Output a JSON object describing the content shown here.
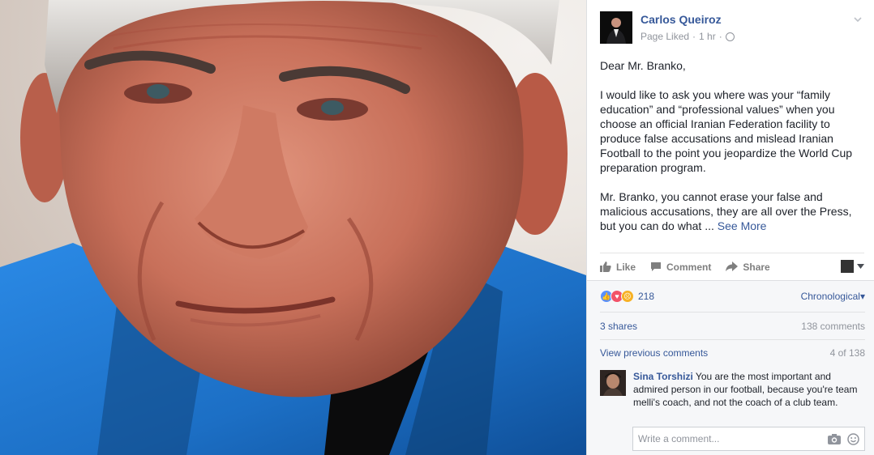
{
  "photo": {
    "subject": "portrait"
  },
  "post": {
    "author": "Carlos Queiroz",
    "meta_status": "Page Liked",
    "meta_sep": "·",
    "meta_time": "1 hr",
    "paragraphs": [
      "Dear Mr. Branko,",
      "I would like to ask you where was your “family education” and “professional values” when you choose an official Iranian Federation facility to produce false accusations and mislead Iranian Football to the point you jeopardize the World Cup preparation program.",
      "Mr. Branko, you cannot erase your false and malicious accusations, they are all over the Press, but you can do what ..."
    ],
    "see_more": "See More"
  },
  "actions": {
    "like": "Like",
    "comment": "Comment",
    "share": "Share"
  },
  "reactions": {
    "count": "218",
    "sort_label": "Chronological"
  },
  "stats": {
    "shares": "3 shares",
    "comments": "138 comments"
  },
  "comments_nav": {
    "view_previous": "View previous comments",
    "pager": "4 of 138"
  },
  "comment": {
    "author": "Sina Torshizi",
    "text": "You are the most important and admired person in our football, because you're team melli's coach, and not the coach of a club team."
  },
  "composer": {
    "placeholder": "Write a comment..."
  },
  "colors": {
    "link": "#365899",
    "jacket": "#1e78d2",
    "muted": "#90949c"
  },
  "icons": [
    "globe-icon",
    "chevron-down-icon",
    "like-icon",
    "comment-icon",
    "share-icon",
    "camera-icon",
    "emoji-icon"
  ]
}
